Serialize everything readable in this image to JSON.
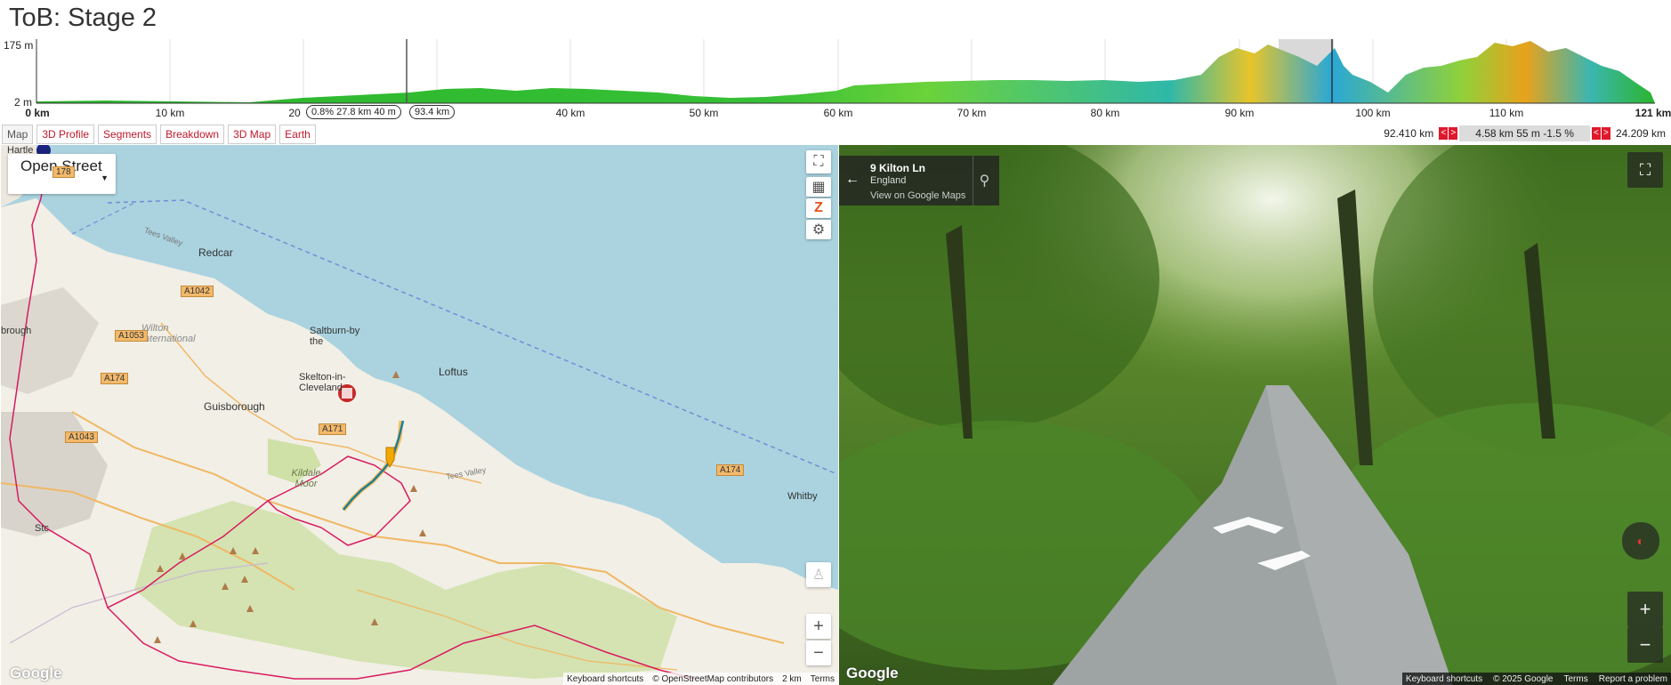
{
  "page": {
    "title": "ToB: Stage 2"
  },
  "profile": {
    "y_max_label": "175 m",
    "y_min_label": "2 m",
    "x_ticks": [
      "0 km",
      "10 km",
      "20",
      "40 km",
      "50 km",
      "60 km",
      "70 km",
      "80 km",
      "90 km",
      "100 km",
      "110 km",
      "121 km"
    ],
    "selection_info": "0.8% 27.8 km 40 m",
    "cursor_info": "93.4 km"
  },
  "tabs": [
    "Map",
    "3D Profile",
    "Segments",
    "Breakdown",
    "3D Map",
    "Earth"
  ],
  "segment": {
    "left_value": "92.410 km",
    "middle": "4.58 km 55 m -1.5 %",
    "right_value": "24.209 km",
    "prev_arrow": "<",
    "next_arrow": ">"
  },
  "map": {
    "layer": "Open Street",
    "labels": {
      "redcar": "Redcar",
      "wilton": "Wilton International",
      "saltburn": "Saltburn-by the",
      "skelton": "Skelton-in-Cleveland",
      "loftus": "Loftus",
      "guisborough": "Guisborough",
      "kildale": "Kildale Moor",
      "whitby": "Whitby",
      "tees_valley": "Tees Valley",
      "tees_valley2": "Tees Valley",
      "brough": "brough",
      "hartle": "Hartle",
      "stoc": "Stc"
    },
    "roads": [
      "A1042",
      "A1053",
      "A174",
      "A1043",
      "A171",
      "A174",
      "178"
    ],
    "footer": {
      "shortcuts": "Keyboard shortcuts",
      "attribution": "© OpenStreetMap contributors",
      "scale": "2 km",
      "terms": "Terms"
    },
    "logo": "Google"
  },
  "streetview": {
    "street": "9 Kilton Ln",
    "region": "England",
    "link": "View on Google Maps",
    "footer": {
      "shortcuts": "Keyboard shortcuts",
      "copyright": "© 2025 Google",
      "terms": "Terms",
      "report": "Report a problem"
    },
    "logo": "Google"
  }
}
